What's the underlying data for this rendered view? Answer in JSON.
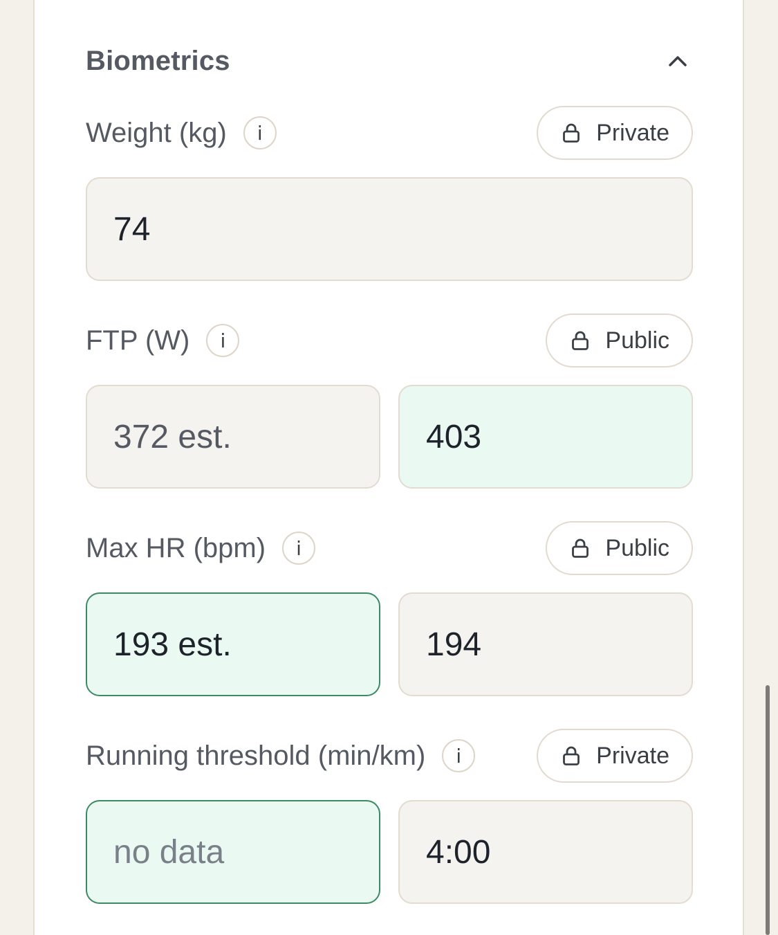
{
  "section": {
    "title": "Biometrics"
  },
  "fields": [
    {
      "label": "Weight (kg)",
      "privacy": "Private",
      "value": "74"
    },
    {
      "label": "FTP (W)",
      "privacy": "Public",
      "estimate": "372 est.",
      "value": "403"
    },
    {
      "label": "Max HR (bpm)",
      "privacy": "Public",
      "estimate": "193 est.",
      "value": "194"
    },
    {
      "label": "Running threshold (min/km)",
      "privacy": "Private",
      "estimate_placeholder": "no data",
      "value": "4:00"
    }
  ],
  "info_glyph": "i",
  "icons": {
    "collapse": "chevron-up-icon",
    "info": "info-icon",
    "lock": "lock-icon"
  },
  "colors": {
    "selected_bg": "#eafaf2",
    "selected_border": "#3b8a63",
    "input_bg": "#f5f3ef"
  }
}
